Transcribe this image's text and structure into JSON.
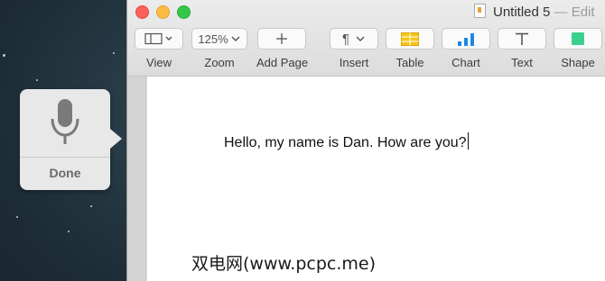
{
  "window": {
    "title": "Untitled 5",
    "title_suffix": "— Edit"
  },
  "toolbar": {
    "view_label": "View",
    "zoom_label": "Zoom",
    "zoom_value": "125%",
    "add_page_label": "Add Page",
    "insert_label": "Insert",
    "table_label": "Table",
    "chart_label": "Chart",
    "text_label": "Text",
    "shape_label": "Shape"
  },
  "document": {
    "text": "Hello, my name is Dan. How are you?"
  },
  "dictation": {
    "done_label": "Done"
  },
  "watermark": "双电网(www.pcpc.me)",
  "colors": {
    "close": "#fc605b",
    "minimize": "#fdbc40",
    "maximize": "#34c84a",
    "table_accent": "#f5c518",
    "chart_accent": "#1e88e5",
    "shape_accent": "#3ccf8e"
  }
}
